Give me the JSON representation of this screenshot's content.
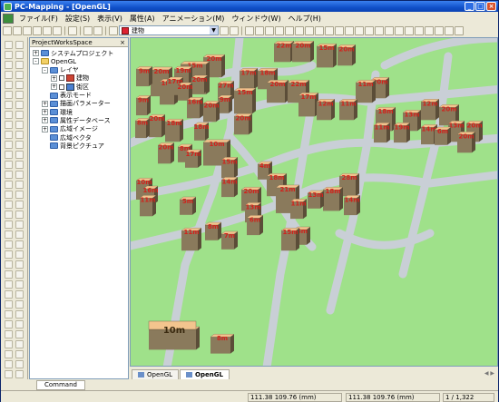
{
  "window": {
    "title": "PC-Mapping - [OpenGL]",
    "controls": [
      "_",
      "□",
      "×"
    ]
  },
  "menu": [
    "ファイル(F)",
    "設定(S)",
    "表示(V)",
    "属性(A)",
    "アニメーション(M)",
    "ウィンドウ(W)",
    "ヘルプ(H)"
  ],
  "toolbar": {
    "layer_select_value": "建物"
  },
  "panel": {
    "title": "ProjectWorksSpace",
    "close": "×",
    "tree": [
      {
        "label": "システムプロジェクト",
        "indent": 0,
        "expander": "+",
        "icon": "folder"
      },
      {
        "label": "OpenGL",
        "indent": 0,
        "expander": "-",
        "icon": "folder-yellow"
      },
      {
        "label": "レイヤ",
        "indent": 1,
        "expander": "-",
        "icon": "folder"
      },
      {
        "label": "建物",
        "indent": 2,
        "expander": "+",
        "icon": "building"
      },
      {
        "label": "街区",
        "indent": 2,
        "expander": "+",
        "icon": "block"
      },
      {
        "label": "表示モード",
        "indent": 1,
        "expander": "",
        "icon": "folder"
      },
      {
        "label": "描画パラメーター",
        "indent": 1,
        "expander": "+",
        "icon": "folder"
      },
      {
        "label": "環境",
        "indent": 1,
        "expander": "+",
        "icon": "folder"
      },
      {
        "label": "属性データベース",
        "indent": 1,
        "expander": "+",
        "icon": "folder"
      },
      {
        "label": "広域イメージ",
        "indent": 1,
        "expander": "+",
        "icon": "folder"
      },
      {
        "label": "広域ベクタ",
        "indent": 1,
        "expander": "",
        "icon": "folder"
      },
      {
        "label": "背景ピクチュア",
        "indent": 1,
        "expander": "",
        "icon": "folder"
      }
    ]
  },
  "tabs": [
    {
      "label": "OpenGL",
      "active": false
    },
    {
      "label": "OpenGL",
      "active": true
    }
  ],
  "command_tab": "Command",
  "status": {
    "coord1": "111.38 109.76 (mm)",
    "coord2": "111.38 109.76 (mm)",
    "scale": "1 / 1,322"
  },
  "map": {
    "ground_color": "#9fe18a",
    "road_color": "#c9cfd6",
    "building_top": "#f3c48e",
    "building_front": "#8a7a5c",
    "building_side": "#5b4d38",
    "label_color": "#d2211b",
    "buildings": [
      {
        "label": "15m"
      },
      {
        "label": "20m"
      },
      {
        "label": "9m"
      },
      {
        "label": "20m"
      },
      {
        "label": "19m"
      },
      {
        "label": "20m"
      },
      {
        "label": "18m"
      },
      {
        "label": "20m"
      },
      {
        "label": "27m"
      },
      {
        "label": "15m"
      },
      {
        "label": "9m"
      },
      {
        "label": "16m"
      },
      {
        "label": "20m"
      },
      {
        "label": "9m"
      },
      {
        "label": "20m"
      },
      {
        "label": "8m"
      },
      {
        "label": "20m"
      },
      {
        "label": "18m"
      },
      {
        "label": "20m"
      },
      {
        "label": "22m"
      },
      {
        "label": "17m"
      },
      {
        "label": "17m"
      },
      {
        "label": "18m"
      },
      {
        "label": "22m"
      },
      {
        "label": "20m"
      },
      {
        "label": "15m"
      },
      {
        "label": "20m"
      },
      {
        "label": "11m"
      },
      {
        "label": "20m"
      },
      {
        "label": "12m"
      },
      {
        "label": "11m"
      },
      {
        "label": "18m"
      },
      {
        "label": "13m"
      },
      {
        "label": "12m"
      },
      {
        "label": "20m"
      },
      {
        "label": "19m"
      },
      {
        "label": "11m"
      },
      {
        "label": "14m"
      },
      {
        "label": "6m"
      },
      {
        "label": "13m"
      },
      {
        "label": "20m"
      },
      {
        "label": "20m"
      },
      {
        "label": "10m"
      },
      {
        "label": "15m"
      },
      {
        "label": "17m"
      },
      {
        "label": "20m"
      },
      {
        "label": "8m"
      },
      {
        "label": "10m"
      },
      {
        "label": "4m"
      },
      {
        "label": "18m"
      },
      {
        "label": "28m"
      },
      {
        "label": "14m"
      },
      {
        "label": "20m"
      },
      {
        "label": "21m"
      },
      {
        "label": "18m"
      },
      {
        "label": "13m"
      },
      {
        "label": "14m"
      },
      {
        "label": "11m"
      },
      {
        "label": "5m"
      },
      {
        "label": "13m"
      },
      {
        "label": "11m"
      },
      {
        "label": "4m"
      },
      {
        "label": "8m"
      },
      {
        "label": "15m"
      },
      {
        "label": "7m"
      },
      {
        "label": "11m"
      },
      {
        "label": "6m"
      },
      {
        "label": "17m"
      },
      {
        "label": "10m"
      },
      {
        "label": "8m"
      },
      {
        "label": "18m"
      },
      {
        "label": "16m"
      }
    ]
  }
}
